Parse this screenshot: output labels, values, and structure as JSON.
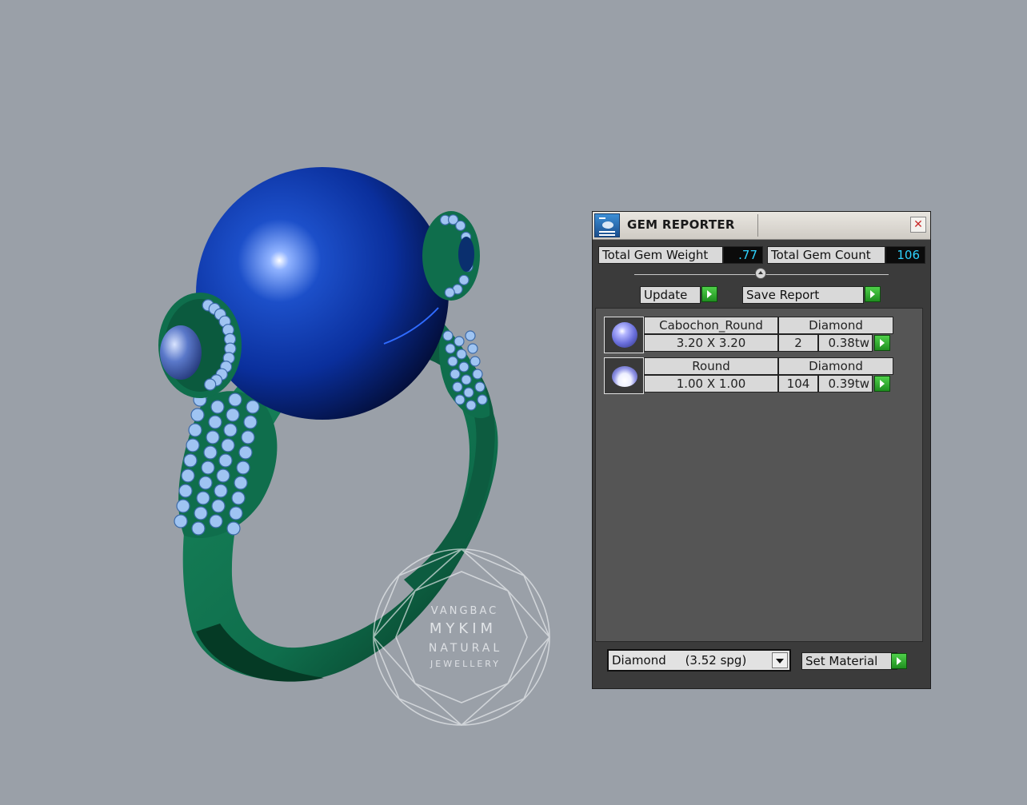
{
  "watermark": {
    "line1": "VANGBAC",
    "line2": "MYKIM",
    "line3": "NATURAL",
    "line4": "JEWELLERY"
  },
  "panel": {
    "title": "GEM REPORTER",
    "close_glyph": "✕",
    "total_weight_label": "Total Gem Weight",
    "total_weight_value": ".77",
    "total_count_label": "Total Gem Count",
    "total_count_value": "106",
    "update_label": "Update",
    "save_report_label": "Save Report",
    "gems": [
      {
        "shape": "Cabochon_Round",
        "material": "Diamond",
        "size": "3.20 X 3.20",
        "count": "2",
        "weight": "0.38tw"
      },
      {
        "shape": "Round",
        "material": "Diamond",
        "size": "1.00 X 1.00",
        "count": "104",
        "weight": "0.39tw"
      }
    ],
    "material_select": "Diamond     (3.52 spg)",
    "set_material_label": "Set Material"
  },
  "colors": {
    "pearl": "#0a2f9c",
    "metal": "#0f6e4c",
    "gems": "#9fc4f2",
    "value_text": "#2ed3ff",
    "go_button": "#2fb32f"
  }
}
